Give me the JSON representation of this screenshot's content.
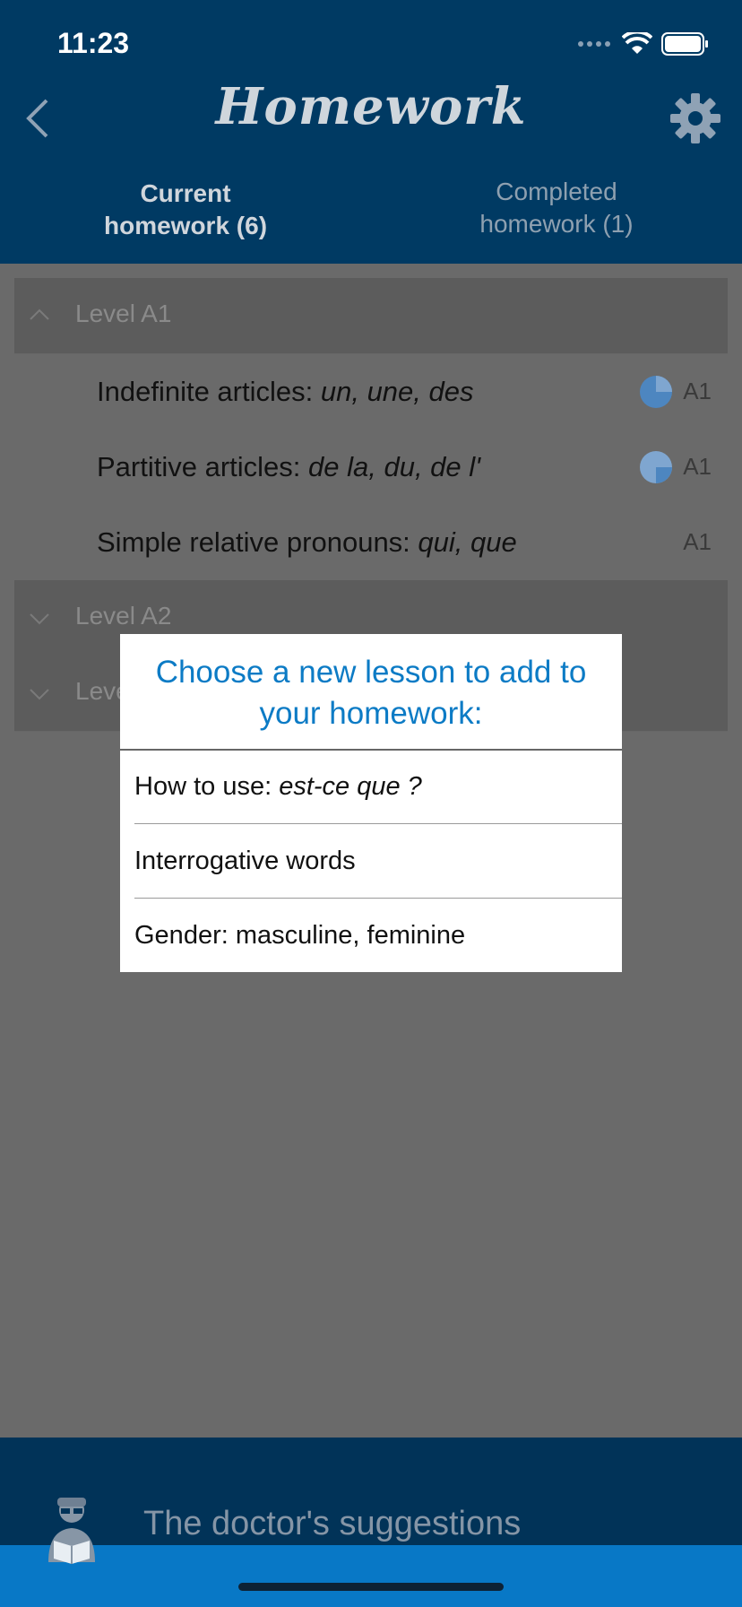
{
  "status_bar": {
    "time": "11:23"
  },
  "header": {
    "title": "Homework",
    "tabs": [
      {
        "label_line1": "Current",
        "label_line2": "homework (6)"
      },
      {
        "label_line1": "Completed",
        "label_line2": "homework (1)"
      }
    ]
  },
  "levels": [
    {
      "label": "Level A1",
      "lessons": [
        {
          "text": "Indefinite articles: ",
          "italic": "un, une, des",
          "level": "A1",
          "progress": 0.75
        },
        {
          "text": "Partitive articles: ",
          "italic": "de la, du, de l'",
          "level": "A1",
          "progress": 0.25
        },
        {
          "text": "Simple relative pronouns: ",
          "italic": "qui, que",
          "level": "A1"
        }
      ]
    },
    {
      "label": "Level A2"
    },
    {
      "label": "Leve"
    }
  ],
  "modal": {
    "title_line1": "Choose a new lesson to add to",
    "title_line2": "your homework:",
    "items": [
      {
        "text": "How to use: ",
        "italic": "est-ce que ?"
      },
      {
        "text": "Interrogative words"
      },
      {
        "text": "Gender: masculine, feminine"
      }
    ]
  },
  "footer": {
    "label": "The doctor's suggestions"
  },
  "colors": {
    "header_bg": "#003a63",
    "accent": "#0c7bc5",
    "footer_bg": "#013358",
    "home_bar_bg": "#0878c6"
  }
}
